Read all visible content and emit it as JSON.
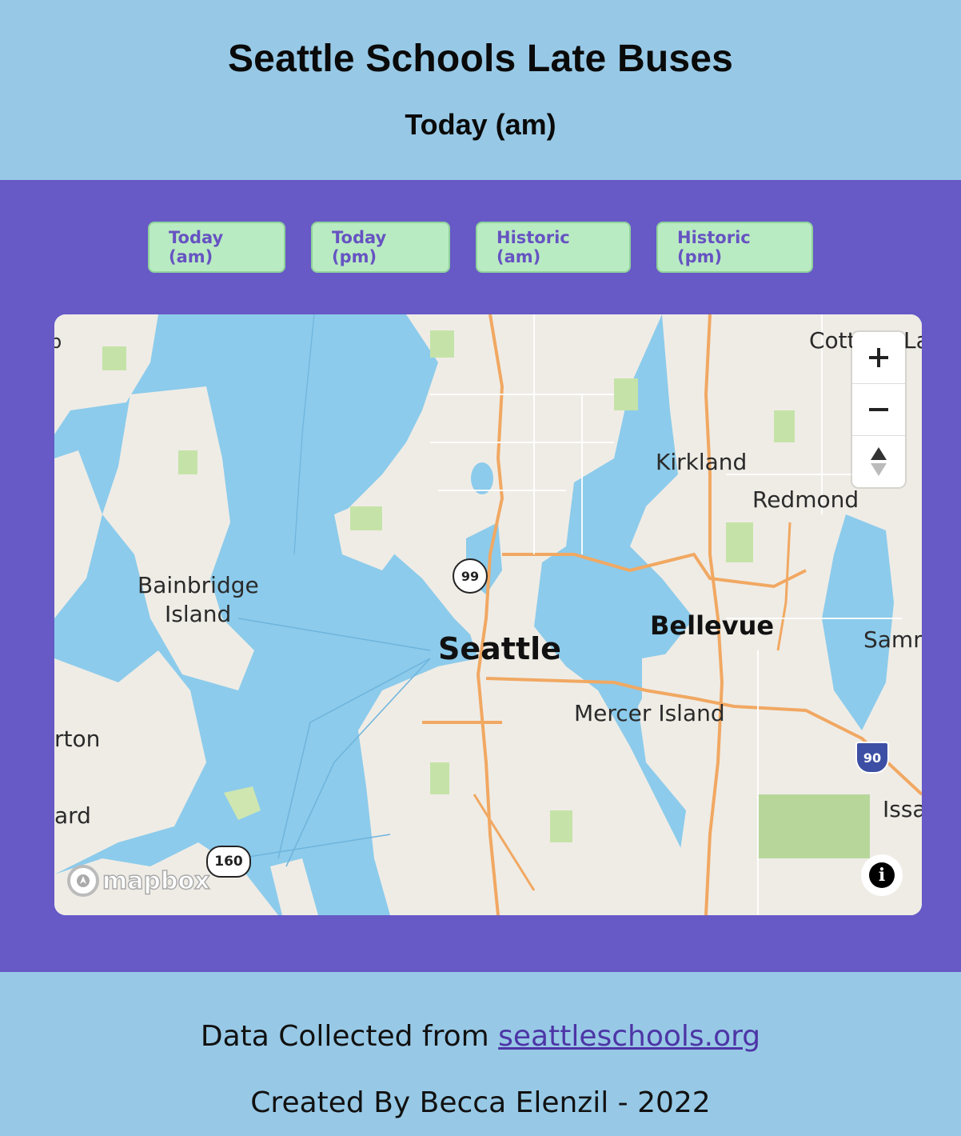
{
  "header": {
    "title": "Seattle Schools Late Buses",
    "subtitle": "Today (am)"
  },
  "tabs": [
    {
      "label": "Today (am)"
    },
    {
      "label": "Today (pm)"
    },
    {
      "label": "Historic (am)"
    },
    {
      "label": "Historic (pm)"
    }
  ],
  "map": {
    "labels": {
      "seattle": "Seattle",
      "bellevue": "Bellevue",
      "kirkland": "Kirkland",
      "redmond": "Redmond",
      "mercer_island": "Mercer Island",
      "bainbridge_1": "Bainbridge",
      "bainbridge_2": "Island",
      "samm": "Samm",
      "issa": "Issa",
      "cott": "Cott",
      "la": "La",
      "rton": "rton",
      "ard": "ard",
      "edge_b": "b"
    },
    "shields": {
      "route99": "99",
      "route160": "160",
      "interstate90": "90"
    },
    "controls": {
      "zoom_in_icon": "plus-icon",
      "zoom_out_icon": "minus-icon",
      "compass_icon": "compass-icon",
      "info_icon": "info-icon"
    },
    "attribution_logo": "mapbox",
    "colors": {
      "water": "#8ccbeb",
      "land": "#efece6",
      "park": "#c5e3a8",
      "highway": "#f1a862"
    }
  },
  "footer": {
    "data_prefix": "Data Collected from",
    "data_link": "seattleschools.org",
    "credit": "Created By Becca Elenzil - 2022"
  },
  "colors": {
    "page_background": "#97c9e6",
    "main_background": "#6759c6",
    "button_background": "#b9ebc2",
    "button_text": "#6653c2"
  }
}
